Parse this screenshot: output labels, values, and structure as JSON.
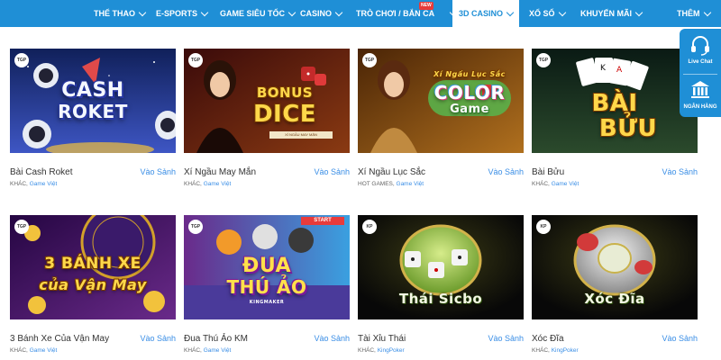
{
  "nav": {
    "items": [
      {
        "label": "THỂ THAO",
        "has_dropdown": true
      },
      {
        "label": "E-SPORTS",
        "has_dropdown": true
      },
      {
        "label": "GAME SIÊU TỐC",
        "has_dropdown": true
      },
      {
        "label": "CASINO",
        "has_dropdown": true
      },
      {
        "label": "TRÒ CHƠI / BẮN CÁ",
        "has_dropdown": true,
        "badge": "NEW"
      },
      {
        "label": "3D CASINO",
        "has_dropdown": true,
        "active": true
      },
      {
        "label": "XỔ SỐ",
        "has_dropdown": true
      },
      {
        "label": "KHUYẾN MÃI",
        "has_dropdown": true
      },
      {
        "label": "THÊM",
        "has_dropdown": true
      }
    ]
  },
  "side_panel": {
    "live_chat": {
      "label": "Live Chat",
      "icon": "headset-icon"
    },
    "bank": {
      "label": "NGÂN HÀNG",
      "icon": "bank-icon"
    }
  },
  "enter_label": "Vào Sảnh",
  "games": [
    {
      "name": "Bài Cash Roket",
      "category": "KHÁC,",
      "provider": "Game Việt",
      "badge": "TGP",
      "art_text": [
        "CASH",
        "ROKET"
      ],
      "bg": [
        "#10205a",
        "#3e56c4"
      ]
    },
    {
      "name": "Xí Ngầu May Mắn",
      "category": "KHÁC,",
      "provider": "Game Việt",
      "badge": "TGP",
      "art_text": [
        "BONUS",
        "DICE"
      ],
      "art_sub": "XÍ NGẦU MAY MẮN",
      "bg": [
        "#3a0a0a",
        "#8a3a12"
      ]
    },
    {
      "name": "Xí Ngầu Lục Sắc",
      "category": "HOT GAMES,",
      "provider": "Game Việt",
      "badge": "TGP",
      "art_text": [
        "COLOR",
        "Game"
      ],
      "art_sub": "Xí Ngầu Lục Sắc",
      "bg": [
        "#4a2406",
        "#b0701e"
      ]
    },
    {
      "name": "Bài Bửu",
      "category": "KHÁC,",
      "provider": "Game Việt",
      "badge": "TGP",
      "art_text": [
        "BÀI",
        "BỬU"
      ],
      "bg": [
        "#0a1a14",
        "#2b4a2c"
      ]
    },
    {
      "name": "3 Bánh Xe Của Vận May",
      "category": "KHÁC,",
      "provider": "Game Việt",
      "badge": "TGP",
      "art_text": [
        "3 BÁNH XE",
        "của Vận May"
      ],
      "bg": [
        "#250642",
        "#6a2a8a"
      ]
    },
    {
      "name": "Đua Thú Ảo KM",
      "category": "KHÁC,",
      "provider": "Game Việt",
      "badge": "TGP",
      "art_text": [
        "ĐUA",
        "THÚ ẢO"
      ],
      "art_sub": "KINGMAKER",
      "art_extra": "START",
      "bg": [
        "#6a2a8a",
        "#3aa0e0"
      ]
    },
    {
      "name": "Tài Xỉu Thái",
      "category": "KHÁC,",
      "provider": "KingPoker",
      "badge": "KP",
      "art_text": [
        "Thái Sicbo"
      ],
      "bg": [
        "#080808",
        "#2a2a10"
      ]
    },
    {
      "name": "Xóc Đĩa",
      "category": "KHÁC,",
      "provider": "KingPoker",
      "badge": "KP",
      "art_text": [
        "Xóc Đĩa"
      ],
      "bg": [
        "#080808",
        "#2a2a10"
      ]
    }
  ]
}
